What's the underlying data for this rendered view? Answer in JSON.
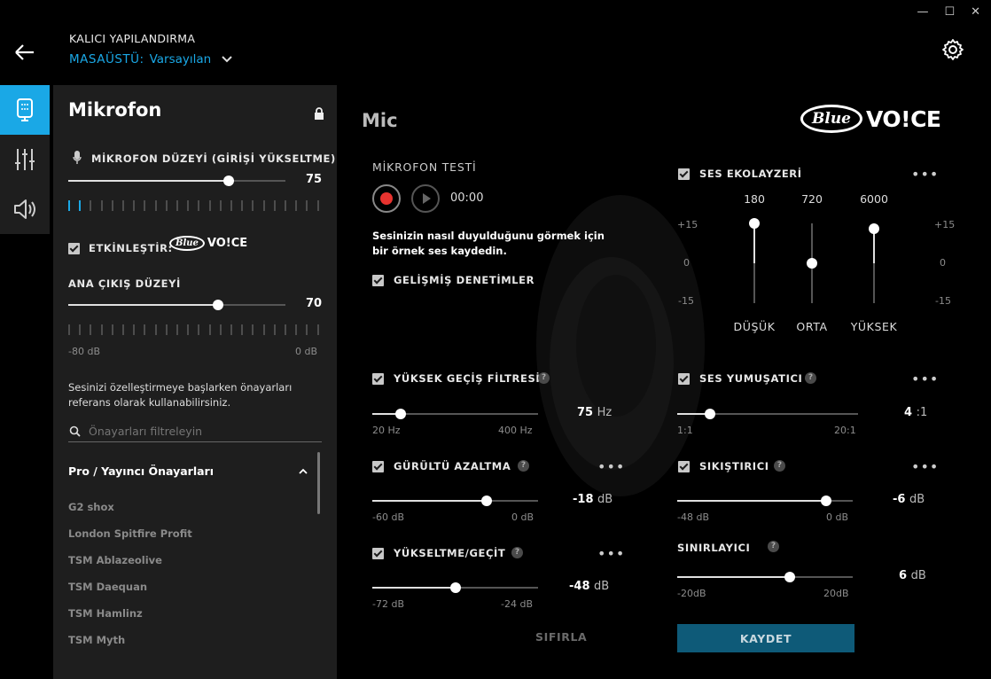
{
  "window": {
    "minimize": "—",
    "maximize": "☐",
    "close": "✕"
  },
  "header": {
    "title": "KALICI YAPILANDIRMA",
    "profile_label": "MASAÜSTÜ:",
    "profile_value": "Varsayılan"
  },
  "left_panel": {
    "title": "Mikrofon",
    "mic_level": {
      "label": "MİKROFON DÜZEYİ (GİRİŞİ YÜKSELTME)",
      "value": "75",
      "level": 0.75,
      "meter_active": 2
    },
    "enable": {
      "label": "ETKİNLEŞTİR:",
      "logo_left": "Blue",
      "logo_right": "VO!CE"
    },
    "main_output": {
      "label": "ANA ÇIKIŞ DÜZEYİ",
      "value": "70",
      "level": 0.7,
      "min": "-80 dB",
      "max": "0 dB"
    },
    "presets_hint": "Sesinizi özelleştirmeye başlarken önayarları referans olarak kullanabilirsiniz.",
    "search_placeholder": "Önayarları filtreleyin",
    "preset_group": "Pro / Yayıncı Önayarları",
    "presets": [
      "G2 shox",
      "London Spitfire Profit",
      "TSM Ablazeolive",
      "TSM Daequan",
      "TSM Hamlinz",
      "TSM Myth"
    ]
  },
  "main": {
    "title": "Mic",
    "brand_left": "Blue",
    "brand_right": "VO!CE",
    "test": {
      "label": "MİKROFON TESTİ",
      "time": "00:00",
      "hint": "Sesinizin nasıl duyulduğunu görmek için bir örnek ses kaydedin."
    },
    "advanced": "GELİŞMİŞ DENETİMLER",
    "high_pass": {
      "label": "YÜKSEK GEÇİŞ FİLTRESİ",
      "value": "75",
      "unit": "Hz",
      "level": 0.17,
      "min": "20 Hz",
      "max": "400 Hz"
    },
    "noise": {
      "label": "GÜRÜLTÜ AZALTMA",
      "value": "-18",
      "unit": "dB",
      "level": 0.7,
      "min": "-60 dB",
      "max": "0 dB"
    },
    "gate": {
      "label": "YÜKSELTME/GEÇİT",
      "value": "-48",
      "unit": "dB",
      "level": 0.5,
      "min": "-72 dB",
      "max": "-24 dB"
    },
    "eq": {
      "label": "SES EKOLAYZERİ",
      "bands": [
        {
          "freq": "180",
          "name": "DÜŞÜK",
          "gain": 15
        },
        {
          "freq": "720",
          "name": "ORTA",
          "gain": 0
        },
        {
          "freq": "6000",
          "name": "YÜKSEK",
          "gain": 13
        }
      ],
      "left_scale": [
        "+15",
        "0",
        "-15"
      ],
      "right_scale": [
        "+15",
        "0",
        "-15"
      ]
    },
    "deesser": {
      "label": "SES YUMUŞATICI",
      "value": "4",
      "unit": ":1",
      "level": 0.18,
      "min": "1:1",
      "max": "20:1"
    },
    "compressor": {
      "label": "SIKIŞTIRICI",
      "value": "-6",
      "unit": "dB",
      "level": 0.84,
      "min": "-48 dB",
      "max": "0 dB"
    },
    "limiter": {
      "label": "SINIRLAYICI",
      "value": "6",
      "unit": "dB",
      "level": 0.64,
      "min": "-20dB",
      "max": "20dB"
    },
    "help": "?",
    "more": "•••",
    "reset": "SIFIRLA",
    "save": "KAYDET"
  }
}
